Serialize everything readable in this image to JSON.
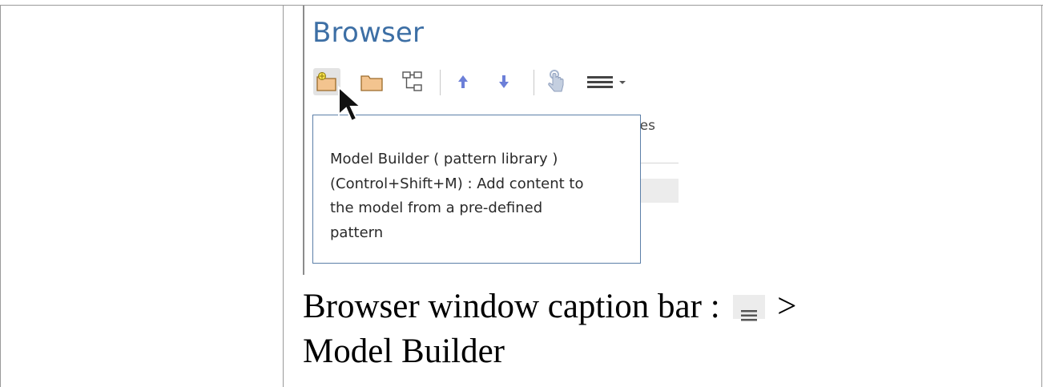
{
  "browser_panel": {
    "title": "Browser",
    "toolbar": [
      {
        "name": "model-builder-button",
        "icon": "folder-star-icon",
        "active": true
      },
      {
        "name": "new-package-button",
        "icon": "folder-icon"
      },
      {
        "name": "new-diagram-button",
        "icon": "hierarchy-icon"
      },
      {
        "name": "move-up-button",
        "icon": "arrow-up-icon"
      },
      {
        "name": "move-down-button",
        "icon": "arrow-down-icon"
      },
      {
        "name": "lock-button",
        "icon": "hand-pointer-icon"
      },
      {
        "name": "menu-button",
        "icon": "hamburger-menu-icon"
      }
    ],
    "background_text": "tes",
    "colors": {
      "title": "#3d6fa5",
      "arrow": "#6c7fd8",
      "tooltip_border": "#5c7fa8",
      "folder_fill": "#f3c48f",
      "folder_stroke": "#9c6b2a"
    }
  },
  "tooltip": {
    "lines": [
      "Model Builder ( pattern library )",
      "(Control+Shift+M) : Add content to",
      "the model from a pre-defined",
      "pattern"
    ]
  },
  "caption": {
    "prefix": "Browser window caption bar :",
    "icon": "hamburger-menu-icon",
    "suffix_line1": ">",
    "line2": "Model Builder"
  }
}
